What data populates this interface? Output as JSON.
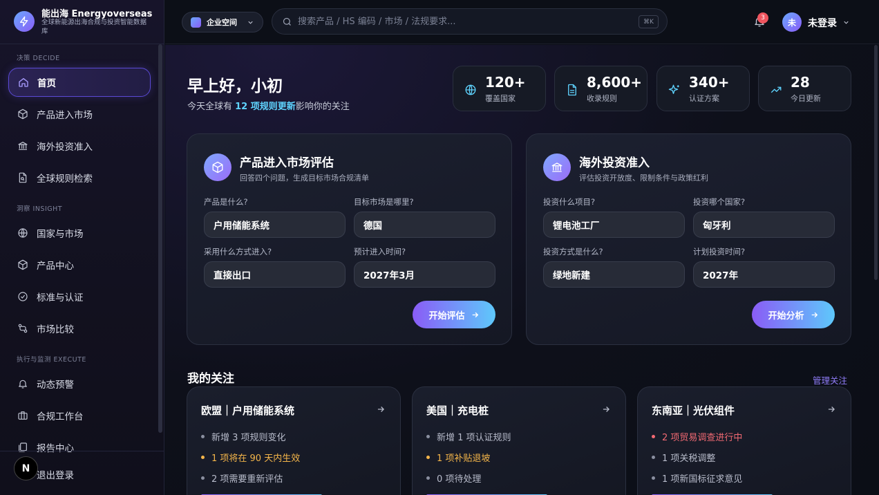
{
  "brand": {
    "name": "能出海 Energyoverseas",
    "subtitle": "全球新能源出海合规与投资智能数据库"
  },
  "sidebar": {
    "sections": [
      {
        "title": "决策 DECIDE"
      },
      {
        "title": "洞察 INSIGHT"
      },
      {
        "title": "执行与监测 EXECUTE"
      }
    ],
    "items": [
      {
        "label": "首页",
        "icon": "home-icon",
        "active": true
      },
      {
        "label": "产品进入市场",
        "icon": "box-icon"
      },
      {
        "label": "海外投资准入",
        "icon": "bank-icon"
      },
      {
        "label": "全球规则检索",
        "icon": "file-search-icon"
      },
      {
        "label": "国家与市场",
        "icon": "globe-icon"
      },
      {
        "label": "产品中心",
        "icon": "box-icon"
      },
      {
        "label": "标准与认证",
        "icon": "check-circle-icon"
      },
      {
        "label": "市场比较",
        "icon": "compare-icon"
      },
      {
        "label": "动态预警",
        "icon": "bell-icon"
      },
      {
        "label": "合规工作台",
        "icon": "briefcase-icon"
      },
      {
        "label": "报告中心",
        "icon": "report-icon"
      }
    ],
    "logout": "退出登录",
    "badge": "N"
  },
  "topbar": {
    "workspace": "企业空间",
    "search_placeholder": "搜索产品 / HS 编码 / 市场 / 法规要求...",
    "shortcut": "⌘K",
    "notifications": "3",
    "avatar": "未",
    "user": "未登录"
  },
  "greeting": {
    "title": "早上好，小初",
    "prefix": "今天全球有 ",
    "highlight": "12 项规则更新",
    "suffix": "影响你的关注"
  },
  "stats": [
    {
      "value": "120+",
      "label": "覆盖国家",
      "icon": "globe-icon"
    },
    {
      "value": "8,600+",
      "label": "收录规则",
      "icon": "document-icon"
    },
    {
      "value": "340+",
      "label": "认证方案",
      "icon": "sparkle-icon"
    },
    {
      "value": "28",
      "label": "今日更新",
      "icon": "trend-up-icon"
    }
  ],
  "product_panel": {
    "title": "产品进入市场评估",
    "subtitle": "回答四个问题，生成目标市场合规清单",
    "fields": [
      {
        "label": "产品是什么?",
        "value": "户用储能系统"
      },
      {
        "label": "目标市场是哪里?",
        "value": "德国"
      },
      {
        "label": "采用什么方式进入?",
        "value": "直接出口"
      },
      {
        "label": "预计进入时间?",
        "value": "2027年3月"
      }
    ],
    "button": "开始评估"
  },
  "invest_panel": {
    "title": "海外投资准入",
    "subtitle": "评估投资开放度、限制条件与政策红利",
    "fields": [
      {
        "label": "投资什么项目?",
        "value": "锂电池工厂"
      },
      {
        "label": "投资哪个国家?",
        "value": "匈牙利"
      },
      {
        "label": "投资方式是什么?",
        "value": "绿地新建"
      },
      {
        "label": "计划投资时间?",
        "value": "2027年"
      }
    ],
    "button": "开始分析"
  },
  "watchlist": {
    "title": "我的关注",
    "manage": "管理关注",
    "cards": [
      {
        "title": "欧盟｜户用储能系统",
        "items": [
          {
            "text": "新增 3 项规则变化",
            "level": "normal"
          },
          {
            "text": "1 项将在 90 天内生效",
            "level": "warn"
          },
          {
            "text": "2 项需要重新评估",
            "level": "normal"
          }
        ]
      },
      {
        "title": "美国｜充电桩",
        "items": [
          {
            "text": "新增 1 项认证规则",
            "level": "normal"
          },
          {
            "text": "1 项补贴退坡",
            "level": "warn"
          },
          {
            "text": "0 项待处理",
            "level": "normal"
          }
        ]
      },
      {
        "title": "东南亚｜光伏组件",
        "items": [
          {
            "text": "2 项贸易调查进行中",
            "level": "danger"
          },
          {
            "text": "1 项关税调整",
            "level": "normal"
          },
          {
            "text": "1 项新国标征求意见",
            "level": "normal"
          }
        ]
      }
    ]
  },
  "colors": {
    "accent": "#8a5cf6",
    "accent2": "#5ec8fb",
    "highlight": "#5fd4ff",
    "warn": "#f5b64a",
    "danger": "#f36a73"
  }
}
